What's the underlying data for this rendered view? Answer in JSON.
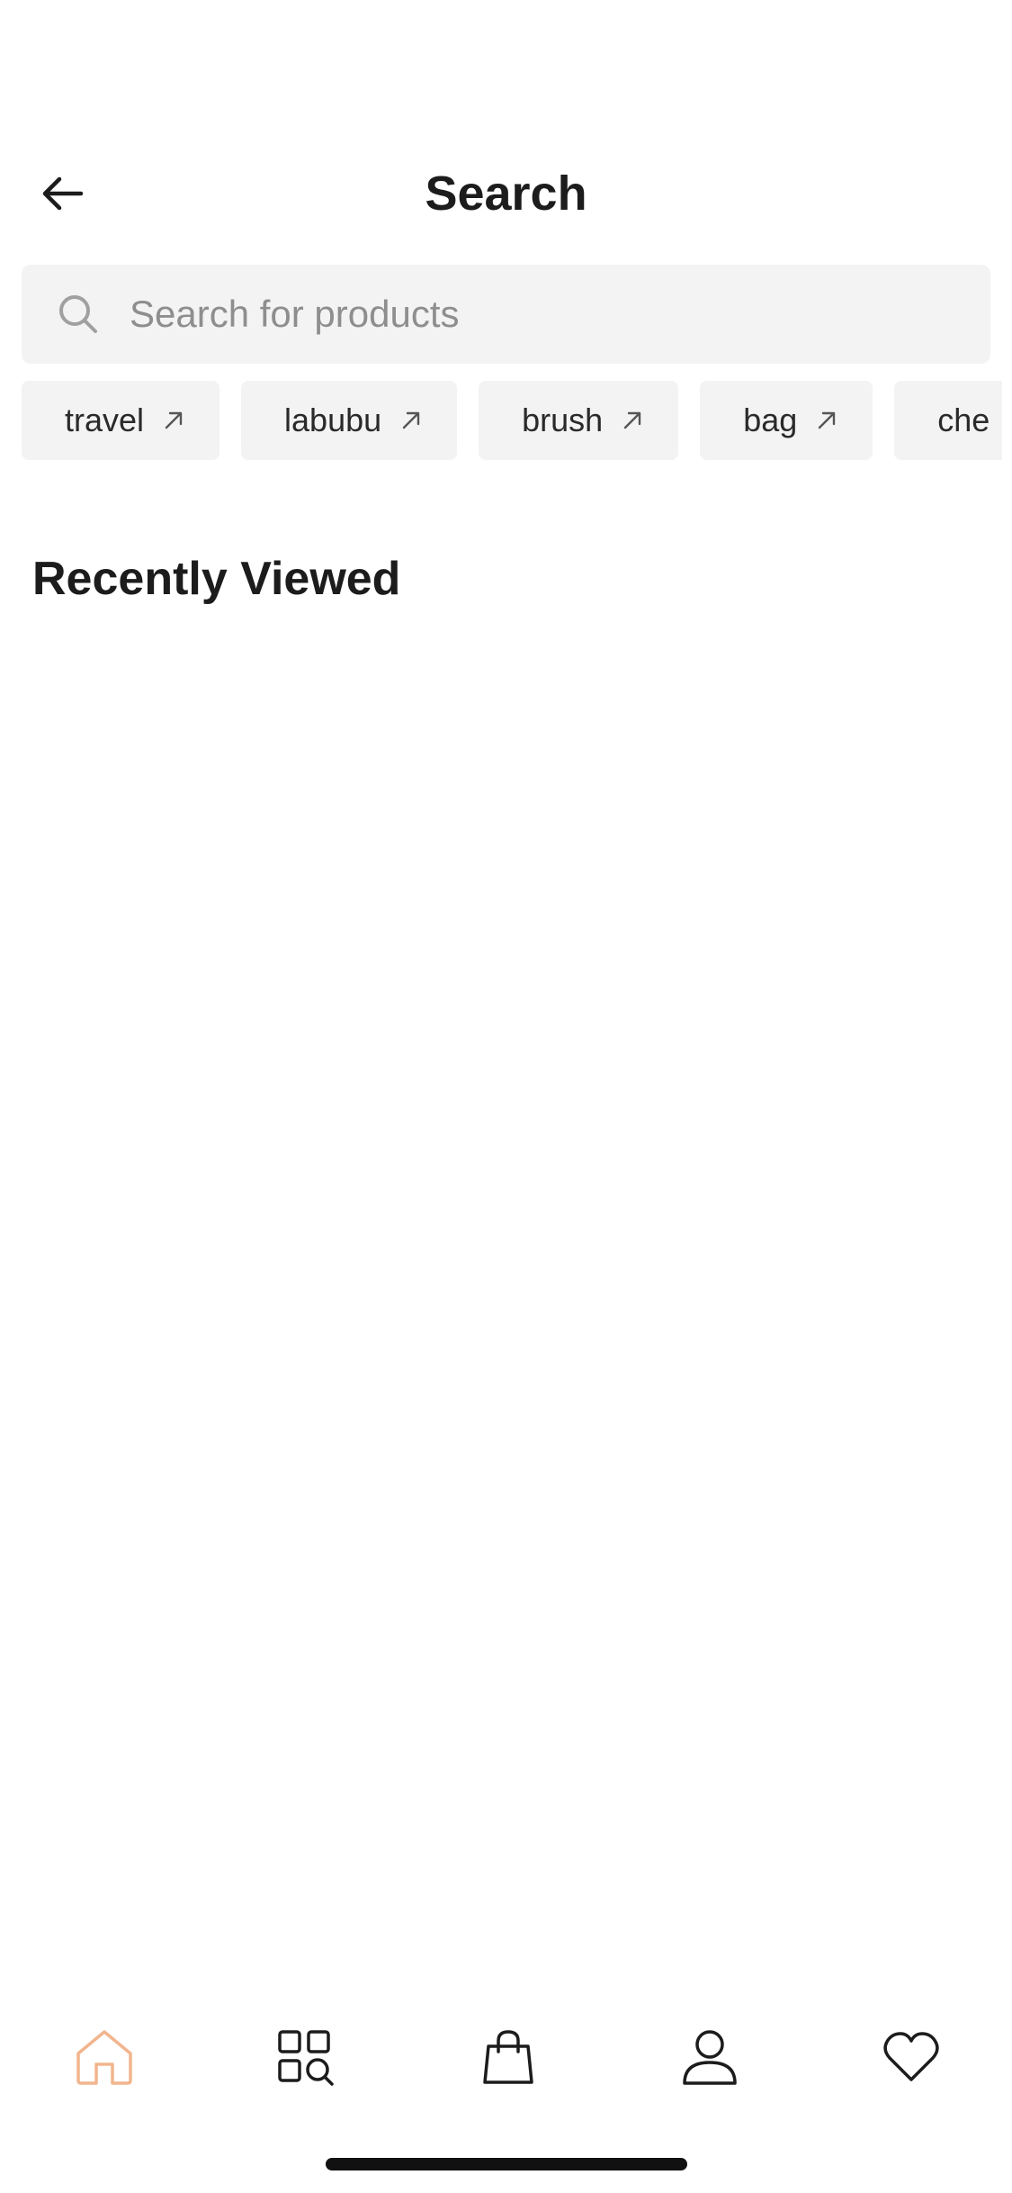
{
  "header": {
    "title": "Search",
    "back_icon": "arrow-left-icon"
  },
  "search": {
    "placeholder": "Search for products",
    "value": "",
    "icon": "search-icon"
  },
  "chips": [
    {
      "label": "travel",
      "icon": "arrow-up-right-icon"
    },
    {
      "label": "labubu",
      "icon": "arrow-up-right-icon"
    },
    {
      "label": "brush",
      "icon": "arrow-up-right-icon"
    },
    {
      "label": "bag",
      "icon": "arrow-up-right-icon"
    },
    {
      "label": "che",
      "icon": "arrow-up-right-icon"
    }
  ],
  "recently_viewed": {
    "title": "Recently Viewed"
  },
  "bottom_nav": {
    "items": [
      {
        "icon": "home-icon",
        "active": true
      },
      {
        "icon": "categories-search-icon",
        "active": false
      },
      {
        "icon": "shopping-bag-icon",
        "active": false
      },
      {
        "icon": "profile-icon",
        "active": false
      },
      {
        "icon": "heart-icon",
        "active": false
      }
    ],
    "active_color": "#F2B58E",
    "inactive_color": "#1C1C1C"
  },
  "colors": {
    "background": "#FFFFFF",
    "input_background": "#F3F3F3",
    "text_primary": "#1C1C1C",
    "placeholder": "#8E8E8E"
  }
}
